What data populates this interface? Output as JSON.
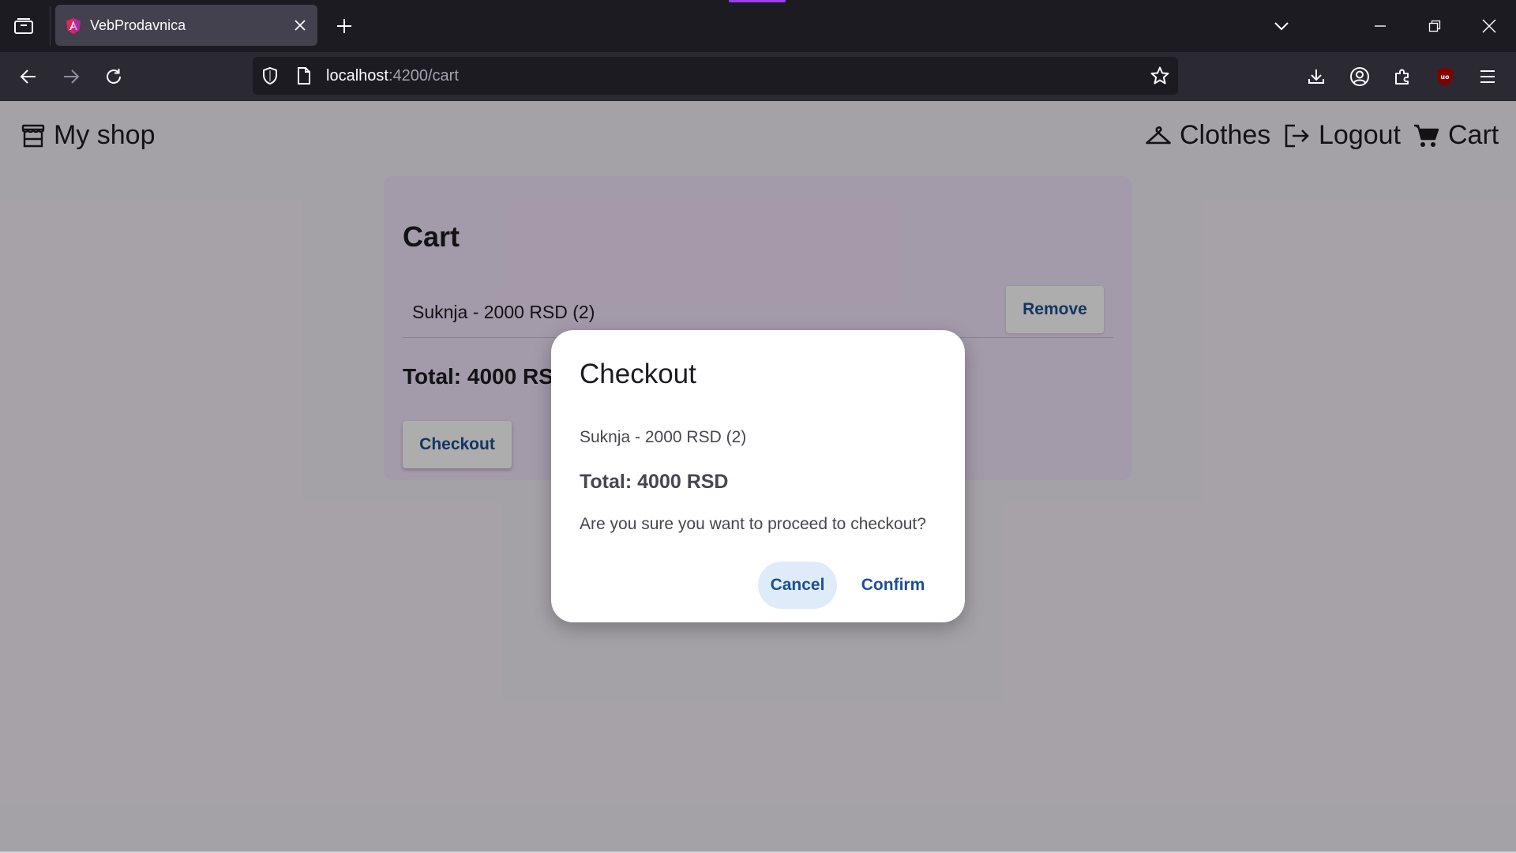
{
  "browser": {
    "tab_title": "VebProdavnica",
    "url_host": "localhost",
    "url_rest": ":4200/cart",
    "icons": {
      "tab_list": "tab-list-icon",
      "close_tab": "close-icon",
      "new_tab": "plus-icon",
      "list_all_tabs": "chevron-down-icon",
      "back": "back-arrow-icon",
      "forward": "forward-arrow-icon",
      "reload": "reload-icon",
      "shield": "shield-icon",
      "page": "page-icon",
      "bookmark": "star-icon",
      "downloads": "download-icon",
      "account": "account-icon",
      "extensions": "puzzle-icon",
      "ublock": "ublock-shield-icon",
      "menu": "hamburger-menu-icon"
    },
    "accent_color": "#9e3cf0"
  },
  "app": {
    "brand": "My shop",
    "nav": {
      "clothes": "Clothes",
      "logout": "Logout",
      "cart": "Cart"
    },
    "icons": {
      "brand": "store-icon",
      "clothes": "hanger-icon",
      "logout": "logout-icon",
      "cart": "shopping-cart-icon"
    }
  },
  "cart": {
    "title": "Cart",
    "items": [
      {
        "text": "Suknja - 2000 RSD (2)",
        "remove_label": "Remove"
      }
    ],
    "total": "Total: 4000 RSD",
    "checkout_label": "Checkout"
  },
  "dialog": {
    "title": "Checkout",
    "item": "Suknja - 2000 RSD (2)",
    "total": "Total: 4000 RSD",
    "question": "Are you sure you want to proceed to checkout?",
    "cancel_label": "Cancel",
    "confirm_label": "Confirm"
  },
  "colors": {
    "primary_text": "#1c4f94",
    "card_background": "#f1e3fb",
    "cancel_background": "#e0ebfa"
  }
}
